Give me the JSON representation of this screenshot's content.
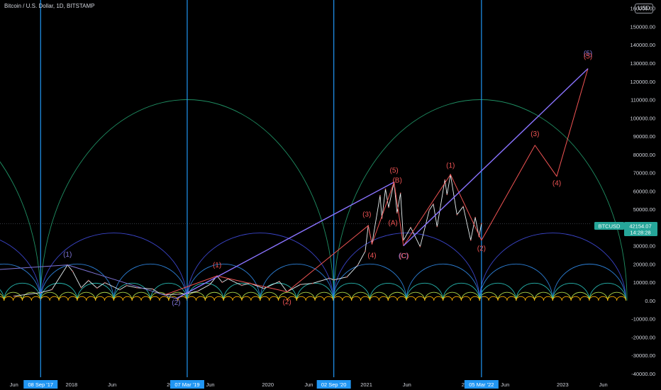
{
  "header": {
    "symbol_title": "Bitcoin / U.S. Dollar, 1D, BITSTAMP",
    "currency_button": "USD"
  },
  "price_badge": {
    "symbol": "BTCUSD",
    "price": "42154.07",
    "countdown": "14:28:28",
    "color": "#26a69a"
  },
  "cycle_markers": [
    {
      "label": "08 Sep '17",
      "color": "#2196f3"
    },
    {
      "label": "07 Mar '19",
      "color": "#2196f3"
    },
    {
      "label": "02 Sep '20",
      "color": "#2196f3"
    },
    {
      "label": "05 Mar '22",
      "color": "#2196f3"
    }
  ],
  "chart_data": {
    "type": "line",
    "title": "Bitcoin / U.S. Dollar, 1D, BITSTAMP",
    "y_axis": {
      "ticks": [
        -40000,
        -30000,
        -20000,
        -10000,
        0,
        10000,
        20000,
        30000,
        40000,
        50000,
        60000,
        70000,
        80000,
        90000,
        100000,
        110000,
        120000,
        130000,
        140000,
        150000,
        160000
      ],
      "tick_labels": [
        "-40000.00",
        "-30000.00",
        "-20000.00",
        "-10000.00",
        "0.00",
        "10000.00",
        "20000.00",
        "30000.00",
        "40000.00",
        "50000.00",
        "60000.00",
        "70000.00",
        "80000.00",
        "90000.00",
        "100000.00",
        "110000.00",
        "120000.00",
        "130000.00",
        "140000.00",
        "150000.00",
        "160000.00"
      ],
      "ylim": [
        -42000,
        163000
      ]
    },
    "x_axis": {
      "labels": [
        {
          "label": "Jun",
          "date": "2017-06-01"
        },
        {
          "label": "2018",
          "date": "2018-01-01"
        },
        {
          "label": "Jun",
          "date": "2018-06-01"
        },
        {
          "label": "20",
          "date": "2019-01-01"
        },
        {
          "label": "Jun",
          "date": "2019-06-01"
        },
        {
          "label": "2020",
          "date": "2020-01-01"
        },
        {
          "label": "Jun",
          "date": "2020-06-01"
        },
        {
          "label": "2021",
          "date": "2021-01-01"
        },
        {
          "label": "Jun",
          "date": "2021-06-01"
        },
        {
          "label": "20",
          "date": "2022-01-01"
        },
        {
          "label": "Jun",
          "date": "2022-06-01"
        },
        {
          "label": "2023",
          "date": "2023-01-01"
        },
        {
          "label": "Jun",
          "date": "2023-06-01"
        }
      ],
      "xlim": [
        "2017-04-10",
        "2023-08-20"
      ]
    },
    "cycle_dates": [
      "2017-09-08",
      "2019-03-07",
      "2020-09-02",
      "2022-03-05"
    ],
    "last_price": 42154.07,
    "price_series": {
      "name": "BTCUSD",
      "color": "#e8f0f2",
      "points": [
        [
          "2017-06-01",
          2400
        ],
        [
          "2017-09-08",
          4300
        ],
        [
          "2017-10-20",
          6000
        ],
        [
          "2017-12-17",
          19500
        ],
        [
          "2018-01-05",
          16000
        ],
        [
          "2018-02-06",
          7000
        ],
        [
          "2018-03-05",
          11000
        ],
        [
          "2018-04-06",
          6800
        ],
        [
          "2018-05-05",
          9800
        ],
        [
          "2018-06-29",
          5900
        ],
        [
          "2018-07-25",
          8200
        ],
        [
          "2018-09-01",
          7000
        ],
        [
          "2018-10-30",
          6300
        ],
        [
          "2018-11-25",
          3800
        ],
        [
          "2018-12-15",
          3200
        ],
        [
          "2019-02-01",
          3450
        ],
        [
          "2019-03-07",
          3850
        ],
        [
          "2019-04-15",
          5100
        ],
        [
          "2019-05-30",
          8700
        ],
        [
          "2019-06-26",
          13500
        ],
        [
          "2019-07-15",
          10000
        ],
        [
          "2019-08-06",
          11800
        ],
        [
          "2019-09-25",
          8300
        ],
        [
          "2019-10-26",
          9500
        ],
        [
          "2019-12-17",
          6600
        ],
        [
          "2020-02-13",
          10400
        ],
        [
          "2020-03-12",
          4800
        ],
        [
          "2020-05-01",
          8800
        ],
        [
          "2020-06-15",
          9400
        ],
        [
          "2020-08-17",
          12200
        ],
        [
          "2020-09-02",
          11300
        ],
        [
          "2020-10-21",
          12900
        ],
        [
          "2020-11-30",
          19400
        ],
        [
          "2020-12-28",
          27000
        ],
        [
          "2021-01-08",
          41000
        ],
        [
          "2021-01-22",
          31000
        ],
        [
          "2021-02-21",
          57500
        ],
        [
          "2021-02-28",
          45000
        ],
        [
          "2021-03-13",
          61000
        ],
        [
          "2021-03-25",
          51000
        ],
        [
          "2021-04-14",
          64800
        ],
        [
          "2021-04-25",
          48000
        ],
        [
          "2021-05-08",
          58800
        ],
        [
          "2021-05-19",
          33000
        ],
        [
          "2021-06-15",
          40000
        ],
        [
          "2021-07-20",
          29500
        ],
        [
          "2021-08-23",
          49500
        ],
        [
          "2021-09-07",
          52800
        ],
        [
          "2021-09-21",
          40500
        ],
        [
          "2021-10-20",
          66000
        ],
        [
          "2021-10-28",
          58000
        ],
        [
          "2021-11-10",
          69000
        ],
        [
          "2021-12-04",
          47000
        ],
        [
          "2021-12-27",
          51500
        ],
        [
          "2022-01-24",
          33000
        ],
        [
          "2022-02-10",
          45500
        ],
        [
          "2022-02-24",
          35000
        ],
        [
          "2022-03-05",
          42154
        ]
      ]
    },
    "wave_labels": [
      {
        "text": "(1)",
        "date": "2017-12-17",
        "value": 24000,
        "color": "#7e74d6"
      },
      {
        "text": "(2)",
        "date": "2019-01-25",
        "value": -2400,
        "color": "#7e74d6"
      },
      {
        "text": "(1)",
        "date": "2019-06-26",
        "value": 18200,
        "color": "#f05454"
      },
      {
        "text": "(2)",
        "date": "2020-03-12",
        "value": -2000,
        "color": "#f05454"
      },
      {
        "text": "(3)",
        "date": "2021-01-03",
        "value": 46000,
        "color": "#f05454"
      },
      {
        "text": "(4)",
        "date": "2021-01-22",
        "value": 23500,
        "color": "#f05454"
      },
      {
        "text": "(5)",
        "date": "2021-04-14",
        "value": 70000,
        "color": "#f05454"
      },
      {
        "text": "(B)",
        "date": "2021-04-26",
        "value": 64500,
        "color": "#f05454"
      },
      {
        "text": "(A)",
        "date": "2021-04-10",
        "value": 41300,
        "color": "#f05454"
      },
      {
        "text": "(C)",
        "date": "2021-05-19",
        "value": 23300,
        "color": "#7e74d6"
      },
      {
        "text": "(C)",
        "date": "2021-05-21",
        "value": 23300,
        "color": "#f05454"
      },
      {
        "text": "(1)",
        "date": "2021-11-10",
        "value": 72800,
        "color": "#f05454"
      },
      {
        "text": "(2)",
        "date": "2022-03-05",
        "value": 27300,
        "color": "#f05454"
      },
      {
        "text": "(3)",
        "date": "2022-09-20",
        "value": 90000,
        "color": "#f05454"
      },
      {
        "text": "(4)",
        "date": "2022-12-10",
        "value": 63000,
        "color": "#f05454"
      },
      {
        "text": "(5)",
        "date": "2023-04-05",
        "value": 134000,
        "color": "#7e74d6"
      },
      {
        "text": "(5)",
        "date": "2023-04-05",
        "value": 132500,
        "color": "#f05454"
      }
    ],
    "lines": [
      {
        "name": "wave-path-red",
        "color": "#f05454",
        "width": 1,
        "points": [
          [
            "2018-12-15",
            3200
          ],
          [
            "2019-06-26",
            13500
          ],
          [
            "2020-03-12",
            4800
          ],
          [
            "2021-01-08",
            41000
          ],
          [
            "2021-01-22",
            31000
          ],
          [
            "2021-04-14",
            64800
          ],
          [
            "2021-05-19",
            30000
          ],
          [
            "2021-04-14",
            64800
          ],
          [
            "2021-05-19",
            30000
          ],
          [
            "2021-11-10",
            69000
          ],
          [
            "2022-03-05",
            33000
          ],
          [
            "2022-09-20",
            85000
          ],
          [
            "2022-12-10",
            68000
          ],
          [
            "2023-04-05",
            127000
          ]
        ]
      },
      {
        "name": "wave-path-purple",
        "color": "#7e74d6",
        "width": 1,
        "points": [
          [
            "2017-04-10",
            17000
          ],
          [
            "2017-12-17",
            19500
          ],
          [
            "2019-01-25",
            1000
          ]
        ]
      },
      {
        "name": "trendline-upper",
        "color": "#8a73ff",
        "width": 1.4,
        "points": [
          [
            "2019-01-25",
            1000
          ],
          [
            "2021-04-14",
            64800
          ]
        ]
      },
      {
        "name": "trendline-lower",
        "color": "#8a73ff",
        "width": 1.4,
        "points": [
          [
            "2021-05-19",
            30000
          ],
          [
            "2023-04-05",
            127000
          ]
        ]
      }
    ],
    "arcs": {
      "origins": [
        "2017-09-08",
        "2019-03-07",
        "2020-09-02",
        "2022-03-05"
      ],
      "levels": [
        {
          "half_span_days": 545,
          "peak_value": 110000,
          "color": "#1f8f63"
        },
        {
          "half_span_days": 272,
          "peak_value": 37000,
          "color": "#3b45c9"
        },
        {
          "half_span_days": 136,
          "peak_value": 20000,
          "color": "#2c7fd6"
        },
        {
          "half_span_days": 68,
          "peak_value": 9500,
          "color": "#27b7b0"
        },
        {
          "half_span_days": 34,
          "peak_value": 4500,
          "color": "#a6d24a"
        },
        {
          "half_span_days": 17,
          "peak_value": 2200,
          "color": "#ffb300"
        }
      ]
    }
  }
}
